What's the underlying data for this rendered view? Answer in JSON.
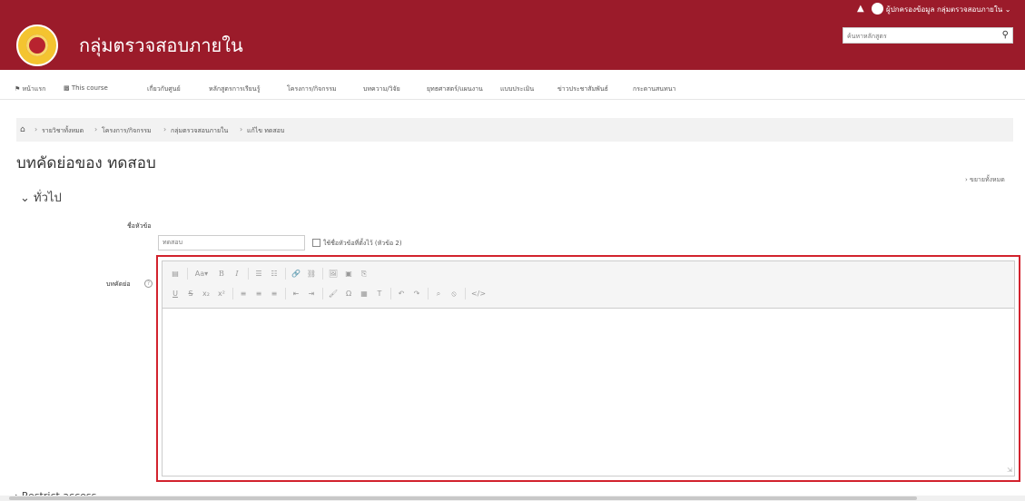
{
  "topbar": {
    "user_name": "ผู้ปกครองข้อมูล กลุ่มตรวจสอบภายใน",
    "user_caret": "⌄"
  },
  "header": {
    "site_title": "กลุ่มตรวจสอบภายใน",
    "search_placeholder": "ค้นหาหลักสูตร"
  },
  "nav": {
    "items": [
      "หน้าแรก",
      "This course",
      "เกี่ยวกับศูนย์",
      "หลักสูตรการเรียนรู้",
      "โครงการ/กิจกรรม",
      "บทความ/วิจัย",
      "ยุทธศาสตร์/แผนงาน",
      "แบบประเมิน",
      "ข่าวประชาสัมพันธ์",
      "กระดานสนทนา"
    ]
  },
  "breadcrumb": {
    "items": [
      "รายวิชาทั้งหมด",
      "โครงการ/กิจกรรม",
      "กลุ่มตรวจสอบภายใน",
      "แก้ไข ทดสอบ"
    ]
  },
  "page": {
    "heading": "บทคัดย่อของ ทดสอบ",
    "expand_all": "ขยายทั้งหมด",
    "section_general": "ทั่วไป",
    "name_label": "ชื่อหัวข้อ",
    "name_value": "ทดสอบ",
    "use_default_label": "ใช้ชื่อหัวข้อที่ตั้งไว้ (หัวข้อ 2)",
    "summary_label": "บทคัดย่อ",
    "help_glyph": "?",
    "restrict_access": "Restrict access"
  },
  "editor": {
    "row1": [
      "▤",
      "Aa▾",
      "B",
      "I",
      "☰",
      "☷",
      "🔗",
      "⛓",
      "🖼",
      "▣",
      "⎘"
    ],
    "row2": [
      "U",
      "S",
      "x₂",
      "x²",
      "≡",
      "≡",
      "≡",
      "⇤",
      "⇥",
      "🖌",
      "Ω",
      "▦",
      "T",
      "↶",
      "↷",
      "⌕",
      "⦸",
      "</>"
    ]
  }
}
